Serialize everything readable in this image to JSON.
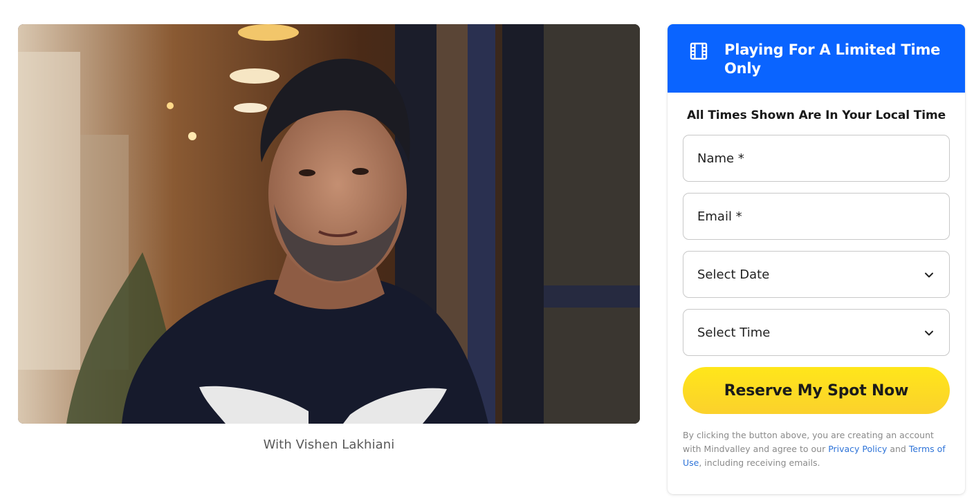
{
  "hero": {
    "caption": "With Vishen Lakhiani"
  },
  "card": {
    "header_title": "Playing For A Limited Time Only",
    "header_icon": "film-icon",
    "local_time_note": "All Times Shown Are In Your Local Time",
    "fields": {
      "name_placeholder": "Name *",
      "email_placeholder": "Email *",
      "date_select_value": "Select Date",
      "time_select_value": "Select Time"
    },
    "submit_label": "Reserve My Spot Now",
    "legal": {
      "text_before": "By clicking the button above, you are creating an account with Mindvalley and agree to our ",
      "privacy_link": "Privacy Policy",
      "and_text": " and ",
      "terms_link": "Terms of Use",
      "text_after": ", including receiving emails."
    }
  },
  "colors": {
    "header_blue": "#0a64ff",
    "button_yellow": "#ffe61a",
    "link_blue": "#2f74d8"
  }
}
